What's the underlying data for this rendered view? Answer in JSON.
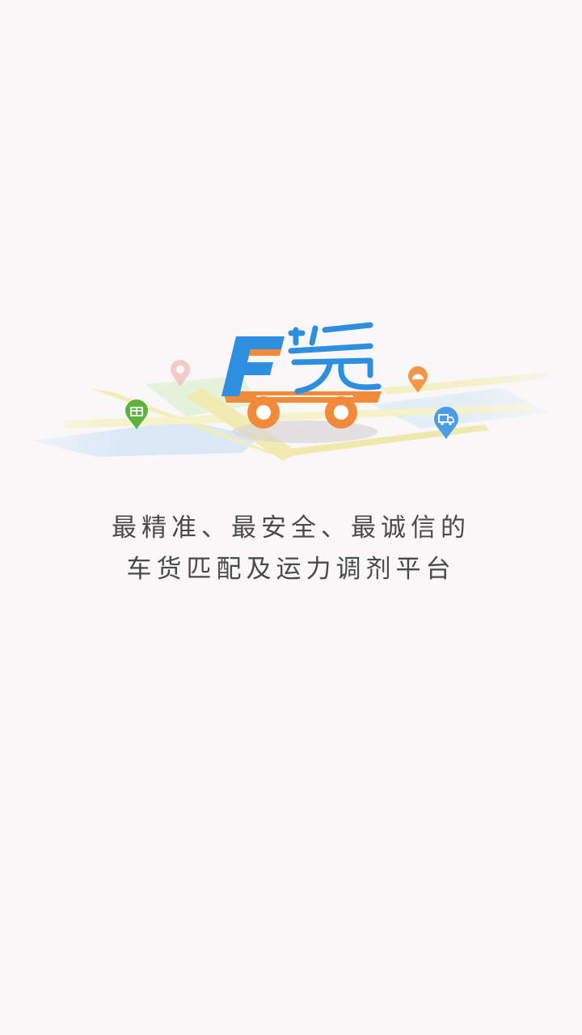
{
  "splash": {
    "logo": {
      "letter": "F",
      "mark": "货"
    },
    "pins": [
      {
        "icon": "gift-pin-icon",
        "color": "#5db33f"
      },
      {
        "icon": "location-pin-icon",
        "color": "#f2a6a6"
      },
      {
        "icon": "cargo-pin-icon",
        "color": "#f2964a"
      },
      {
        "icon": "truck-pin-icon",
        "color": "#4a9ee6"
      }
    ],
    "tagline": {
      "line1": "最精准、最安全、最诚信的",
      "line2": "车货匹配及运力调剂平台"
    },
    "colors": {
      "brand_blue": "#2e8fe0",
      "brand_orange": "#f28a3a",
      "background": "#f9f7f8"
    }
  }
}
